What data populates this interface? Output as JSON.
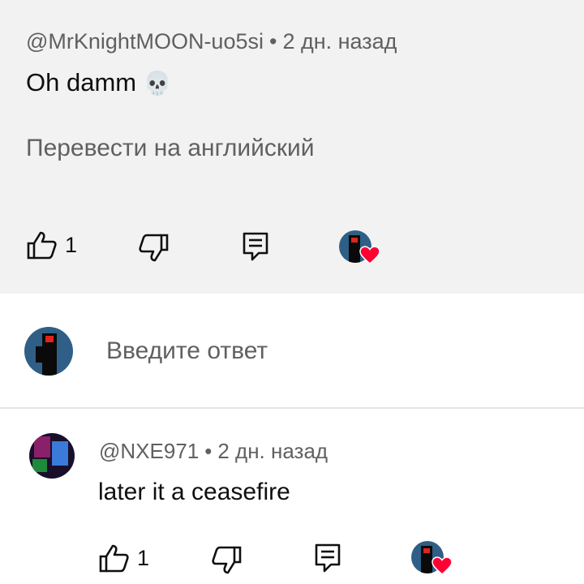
{
  "comment": {
    "author": "@MrKnightMOON-uo5si",
    "separator": "•",
    "time": "2 дн. назад",
    "text": "Oh damm",
    "emoji": "💀",
    "translate_label": "Перевести на английский",
    "likes": "1"
  },
  "reply_box": {
    "placeholder": "Введите ответ"
  },
  "reply": {
    "author": "@NXE971",
    "separator": "•",
    "time": "2 дн. назад",
    "text": "later it a ceasefire",
    "likes": "1"
  },
  "icons": {
    "like": "thumbs-up-icon",
    "dislike": "thumbs-down-icon",
    "reply": "comment-reply-icon",
    "heart": "heart-icon"
  },
  "colors": {
    "card_bg": "#f2f2f2",
    "meta_text": "#606060",
    "heart": "#ff0033",
    "divider": "#e5e5e5"
  }
}
